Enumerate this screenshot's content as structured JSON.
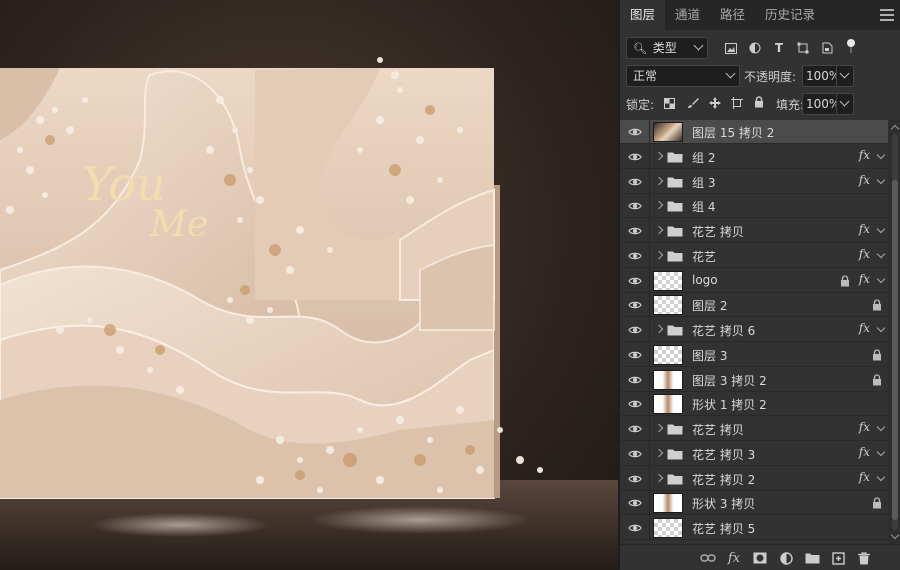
{
  "canvas": {
    "logo_text_1": "You",
    "logo_text_2": "Me"
  },
  "panel": {
    "tabs": [
      {
        "label": "图层",
        "active": true
      },
      {
        "label": "通道",
        "active": false
      },
      {
        "label": "路径",
        "active": false
      },
      {
        "label": "历史记录",
        "active": false
      }
    ],
    "filter": {
      "label": "类型"
    },
    "blend_mode": "正常",
    "opacity_label": "不透明度:",
    "opacity_value": "100%",
    "lock_label": "锁定:",
    "fill_label": "填充:",
    "fill_value": "100%",
    "fx_symbol": "fx"
  },
  "layers": [
    {
      "name": "图层 15 拷贝 2",
      "kind": "image",
      "selected": true,
      "fx": false,
      "lock": false
    },
    {
      "name": "组 2",
      "kind": "group",
      "fx": true,
      "lock": false
    },
    {
      "name": "组 3",
      "kind": "group",
      "fx": true,
      "lock": false
    },
    {
      "name": "组 4",
      "kind": "group",
      "fx": false,
      "lock": false
    },
    {
      "name": "花艺 拷贝",
      "kind": "group",
      "fx": true,
      "lock": false
    },
    {
      "name": "花艺",
      "kind": "group",
      "fx": true,
      "lock": false
    },
    {
      "name": "logo",
      "kind": "layer",
      "fx": true,
      "lock": true
    },
    {
      "name": "图层 2",
      "kind": "layer",
      "fx": false,
      "lock": true
    },
    {
      "name": "花艺 拷贝 6",
      "kind": "group",
      "fx": true,
      "lock": false
    },
    {
      "name": "图层 3",
      "kind": "layer",
      "fx": false,
      "lock": true
    },
    {
      "name": "图层 3 拷贝 2",
      "kind": "shape",
      "fx": false,
      "lock": true
    },
    {
      "name": "形状 1 拷贝 2",
      "kind": "shape",
      "fx": false,
      "lock": false
    },
    {
      "name": "花艺 拷贝",
      "kind": "group",
      "fx": true,
      "lock": false
    },
    {
      "name": "花艺 拷贝 3",
      "kind": "group",
      "fx": true,
      "lock": false
    },
    {
      "name": "花艺 拷贝 2",
      "kind": "group",
      "fx": true,
      "lock": false
    },
    {
      "name": "形状 3 拷贝",
      "kind": "shape",
      "fx": false,
      "lock": true
    },
    {
      "name": "花艺 拷贝 5",
      "kind": "layer",
      "fx": false,
      "lock": false
    }
  ],
  "colors": {
    "panel_bg": "#323232",
    "tab_bg": "#262626",
    "selected_row": "#4b4b4b",
    "backdrop_cream": "#e7d2bf",
    "flower_gold": "#c89b6a"
  }
}
